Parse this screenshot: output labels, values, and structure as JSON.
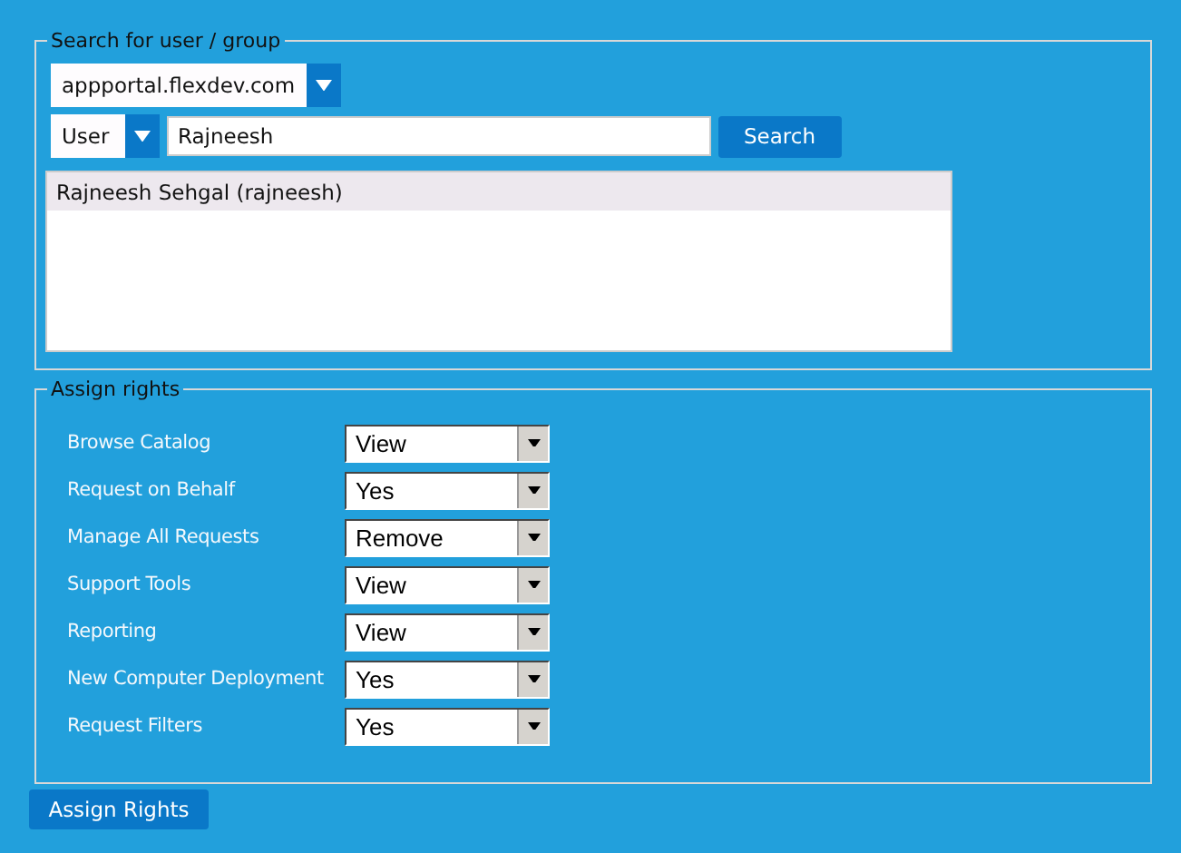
{
  "search_group": {
    "legend": "Search for user / group",
    "domain": "appportal.flexdev.com",
    "type": "User",
    "query": "Rajneesh",
    "search_button": "Search",
    "results": [
      {
        "label": "Rajneesh Sehgal (rajneesh)",
        "selected": true
      }
    ]
  },
  "rights_group": {
    "legend": "Assign rights",
    "rights": [
      {
        "label": "Browse Catalog",
        "value": "View"
      },
      {
        "label": "Request on Behalf",
        "value": "Yes"
      },
      {
        "label": "Manage All Requests",
        "value": "Remove"
      },
      {
        "label": "Support Tools",
        "value": "View"
      },
      {
        "label": "Reporting",
        "value": "View"
      },
      {
        "label": "New Computer Deployment",
        "value": "Yes"
      },
      {
        "label": "Request Filters",
        "value": "Yes"
      }
    ]
  },
  "assign_button": "Assign Rights"
}
